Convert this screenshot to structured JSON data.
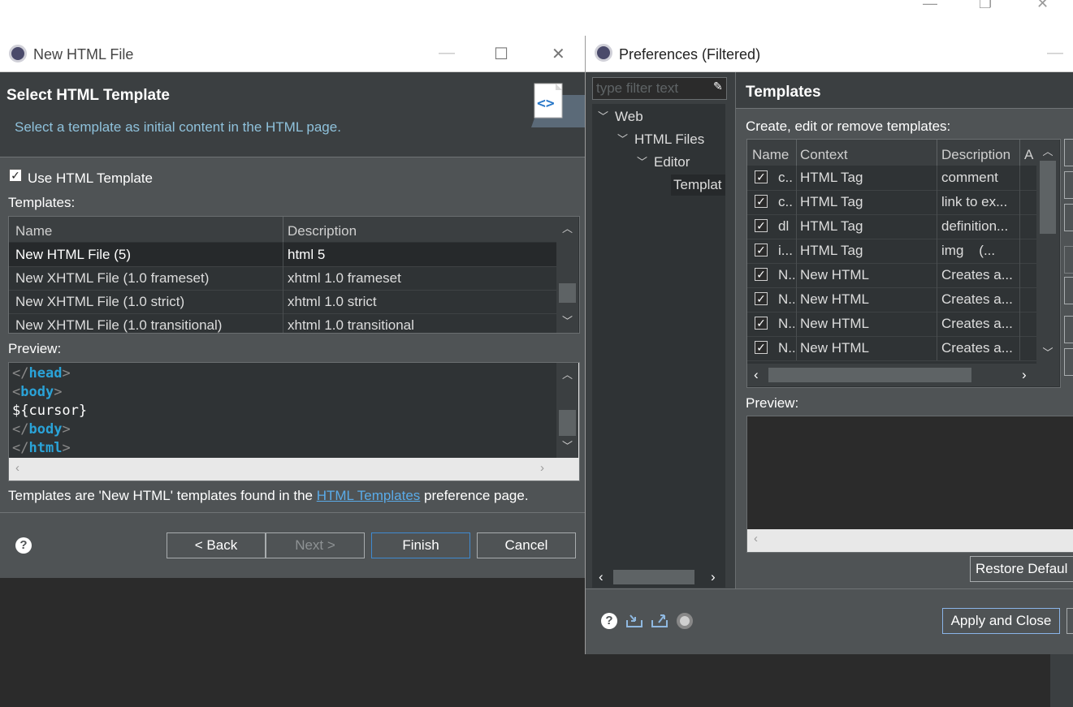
{
  "new_html": {
    "title": "New HTML File",
    "header_title": "Select HTML Template",
    "header_desc": "Select a template as initial content in the HTML page.",
    "use_template_label": "Use HTML Template",
    "templates_label": "Templates:",
    "table": {
      "col_name": "Name",
      "col_desc": "Description",
      "rows": [
        {
          "name": "New HTML File (5)",
          "desc": "html 5"
        },
        {
          "name": "New XHTML File (1.0 frameset)",
          "desc": "xhtml 1.0 frameset"
        },
        {
          "name": "New XHTML File (1.0 strict)",
          "desc": "xhtml 1.0 strict"
        },
        {
          "name": "New XHTML File (1.0 transitional)",
          "desc": "xhtml 1.0 transitional"
        }
      ]
    },
    "preview_label": "Preview:",
    "preview": {
      "l1": "head",
      "l2": "body",
      "l3": "${cursor}",
      "l4": "body",
      "l5": "html",
      "lt": "<",
      "lts": "</",
      "gt": ">"
    },
    "footer_pre": "Templates are 'New HTML' templates found in the ",
    "footer_link": "HTML Templates",
    "footer_post": " preference page.",
    "buttons": {
      "help": "?",
      "back": "< Back",
      "next": "Next >",
      "finish": "Finish",
      "cancel": "Cancel"
    },
    "icons": {
      "header": "html-file-wizard-icon"
    }
  },
  "preferences": {
    "title": "Preferences (Filtered)",
    "filter_placeholder": "type filter text",
    "tree": {
      "web": "Web",
      "html_files": "HTML Files",
      "editor": "Editor",
      "templates": "Templat"
    },
    "page_title": "Templates",
    "desc": "Create, edit or remove templates:",
    "table": {
      "col_name": "Name",
      "col_context": "Context",
      "col_desc": "Description",
      "col_a": "A",
      "rows": [
        {
          "name": "c..",
          "context": "HTML Tag",
          "desc": "comment"
        },
        {
          "name": "c..",
          "context": "HTML Tag",
          "desc": "link to ex..."
        },
        {
          "name": "dl",
          "context": "HTML Tag",
          "desc": "definition..."
        },
        {
          "name": "i...",
          "context": "HTML Tag",
          "desc": "img    (..."
        },
        {
          "name": "N..",
          "context": "New HTML",
          "desc": "Creates a..."
        },
        {
          "name": "N..",
          "context": "New HTML",
          "desc": "Creates a..."
        },
        {
          "name": "N..",
          "context": "New HTML",
          "desc": "Creates a..."
        },
        {
          "name": "N..",
          "context": "New HTML",
          "desc": "Creates a..."
        }
      ]
    },
    "preview_label": "Preview:",
    "restore_defaults": "Restore Defaul",
    "apply_close": "Apply and Close"
  }
}
